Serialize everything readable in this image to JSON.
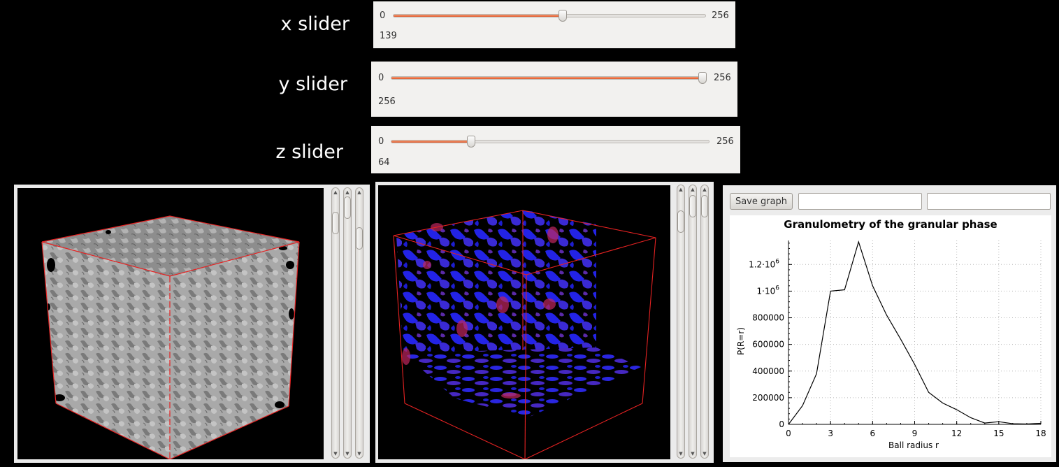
{
  "sliders": [
    {
      "label": "x slider",
      "min": "0",
      "max": "256",
      "value": "139",
      "fraction": 0.543
    },
    {
      "label": "y slider",
      "min": "0",
      "max": "256",
      "value": "256",
      "fraction": 1.0
    },
    {
      "label": "z slider",
      "min": "0",
      "max": "256",
      "value": "64",
      "fraction": 0.25
    }
  ],
  "graph": {
    "save_label": "Save graph",
    "field1": "",
    "field2": ""
  },
  "chart_data": {
    "type": "line",
    "title": "Granulometry of the granular phase",
    "xlabel": "Ball radius r",
    "ylabel": "P(R=r)",
    "xlim": [
      0,
      18
    ],
    "ylim": [
      0,
      1380000
    ],
    "xticks": [
      "0",
      "3",
      "6",
      "9",
      "12",
      "15",
      "18"
    ],
    "yticks": [
      {
        "base": "0",
        "exp": "",
        "value": 0
      },
      {
        "base": "200000",
        "exp": "",
        "value": 200000
      },
      {
        "base": "400000",
        "exp": "",
        "value": 400000
      },
      {
        "base": "600000",
        "exp": "",
        "value": 600000
      },
      {
        "base": "800000",
        "exp": "",
        "value": 800000
      },
      {
        "base": "1·10",
        "exp": "6",
        "value": 1000000
      },
      {
        "base": "1.2·10",
        "exp": "6",
        "value": 1200000
      }
    ],
    "x": [
      0,
      1,
      2,
      3,
      4,
      5,
      6,
      7,
      8,
      9,
      10,
      11,
      12,
      13,
      14,
      15,
      16,
      17,
      18
    ],
    "values": [
      0,
      140000,
      380000,
      1000000,
      1010000,
      1370000,
      1040000,
      820000,
      640000,
      450000,
      240000,
      160000,
      110000,
      50000,
      10000,
      20000,
      5000,
      3000,
      8000
    ],
    "color": "#000000"
  }
}
